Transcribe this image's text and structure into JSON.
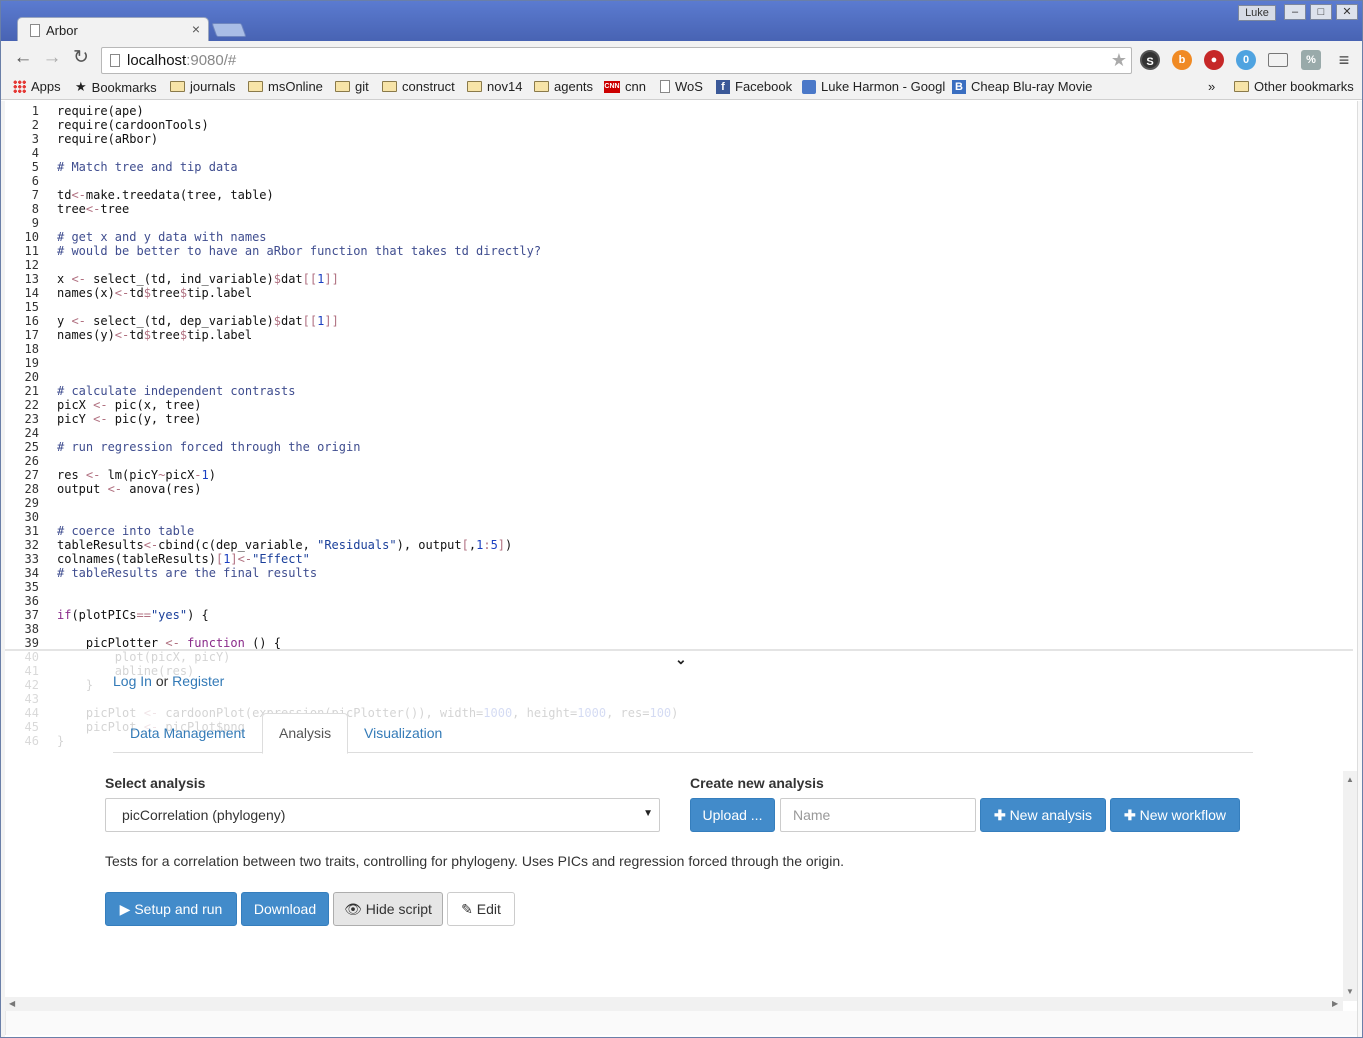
{
  "browser": {
    "tab_title": "Arbor",
    "tab_close": "×",
    "user_label": "Luke",
    "url_host": "localhost",
    "url_rest": ":9080/#",
    "bookmarks": [
      {
        "label": "Apps",
        "icon": "apps-grid-icon"
      },
      {
        "label": "Bookmarks",
        "icon": "star-icon"
      },
      {
        "label": "journals",
        "icon": "folder-icon"
      },
      {
        "label": "msOnline",
        "icon": "folder-icon"
      },
      {
        "label": "git",
        "icon": "folder-icon"
      },
      {
        "label": "construct",
        "icon": "folder-icon"
      },
      {
        "label": "nov14",
        "icon": "folder-icon"
      },
      {
        "label": "agents",
        "icon": "folder-icon"
      },
      {
        "label": "cnn",
        "icon": "cnn-icon"
      },
      {
        "label": "WoS",
        "icon": "page-icon"
      },
      {
        "label": "Facebook",
        "icon": "facebook-icon"
      },
      {
        "label": "Luke Harmon - Googl",
        "icon": "scholar-icon"
      },
      {
        "label": "Cheap Blu-ray Movie",
        "icon": "bluray-icon"
      }
    ],
    "overflow": "»",
    "other_bookmarks": "Other bookmarks",
    "extension_badge": "0"
  },
  "editor": {
    "lines": [
      {
        "n": "1",
        "code": [
          [
            "require(ape)",
            ""
          ]
        ]
      },
      {
        "n": "2",
        "code": [
          [
            "require(cardoonTools)",
            ""
          ]
        ]
      },
      {
        "n": "3",
        "code": [
          [
            "require(aRbor)",
            ""
          ]
        ]
      },
      {
        "n": "4",
        "code": []
      },
      {
        "n": "5",
        "code": [
          [
            "# Match tree and tip data",
            "c-comment"
          ]
        ]
      },
      {
        "n": "6",
        "code": []
      },
      {
        "n": "7",
        "code": [
          [
            "td",
            ""
          ],
          [
            "<-",
            "c-op"
          ],
          [
            "make.treedata(tree, table)",
            ""
          ]
        ]
      },
      {
        "n": "8",
        "code": [
          [
            "tree",
            ""
          ],
          [
            "<-",
            "c-op"
          ],
          [
            "tree",
            ""
          ]
        ]
      },
      {
        "n": "9",
        "code": []
      },
      {
        "n": "10",
        "code": [
          [
            "# get x and y data with names",
            "c-comment"
          ]
        ]
      },
      {
        "n": "11",
        "code": [
          [
            "# would be better to have an aRbor function that takes td directly?",
            "c-comment"
          ]
        ]
      },
      {
        "n": "12",
        "code": []
      },
      {
        "n": "13",
        "code": [
          [
            "x ",
            ""
          ],
          [
            "<-",
            "c-op"
          ],
          [
            " select_(td, ind_variable)",
            ""
          ],
          [
            "$",
            "c-op"
          ],
          [
            "dat",
            ""
          ],
          [
            "[[",
            "c-op"
          ],
          [
            "1",
            "c-num"
          ],
          [
            "]]",
            "c-op"
          ]
        ]
      },
      {
        "n": "14",
        "code": [
          [
            "names(x)",
            ""
          ],
          [
            "<-",
            "c-op"
          ],
          [
            "td",
            ""
          ],
          [
            "$",
            "c-op"
          ],
          [
            "tree",
            ""
          ],
          [
            "$",
            "c-op"
          ],
          [
            "tip.label",
            ""
          ]
        ]
      },
      {
        "n": "15",
        "code": []
      },
      {
        "n": "16",
        "code": [
          [
            "y ",
            ""
          ],
          [
            "<-",
            "c-op"
          ],
          [
            " select_(td, dep_variable)",
            ""
          ],
          [
            "$",
            "c-op"
          ],
          [
            "dat",
            ""
          ],
          [
            "[[",
            "c-op"
          ],
          [
            "1",
            "c-num"
          ],
          [
            "]]",
            "c-op"
          ]
        ]
      },
      {
        "n": "17",
        "code": [
          [
            "names(y)",
            ""
          ],
          [
            "<-",
            "c-op"
          ],
          [
            "td",
            ""
          ],
          [
            "$",
            "c-op"
          ],
          [
            "tree",
            ""
          ],
          [
            "$",
            "c-op"
          ],
          [
            "tip.label",
            ""
          ]
        ]
      },
      {
        "n": "18",
        "code": []
      },
      {
        "n": "19",
        "code": []
      },
      {
        "n": "20",
        "code": []
      },
      {
        "n": "21",
        "code": [
          [
            "# calculate independent contrasts",
            "c-comment"
          ]
        ]
      },
      {
        "n": "22",
        "code": [
          [
            "picX ",
            ""
          ],
          [
            "<-",
            "c-op"
          ],
          [
            " pic(x, tree)",
            ""
          ]
        ]
      },
      {
        "n": "23",
        "code": [
          [
            "picY ",
            ""
          ],
          [
            "<-",
            "c-op"
          ],
          [
            " pic(y, tree)",
            ""
          ]
        ]
      },
      {
        "n": "24",
        "code": []
      },
      {
        "n": "25",
        "code": [
          [
            "# run regression forced through the origin",
            "c-comment"
          ]
        ]
      },
      {
        "n": "26",
        "code": []
      },
      {
        "n": "27",
        "code": [
          [
            "res ",
            ""
          ],
          [
            "<-",
            "c-op"
          ],
          [
            " lm(picY",
            ""
          ],
          [
            "~",
            "c-op"
          ],
          [
            "picX",
            ""
          ],
          [
            "-",
            "c-op"
          ],
          [
            "1",
            "c-num"
          ],
          [
            ")",
            ""
          ]
        ]
      },
      {
        "n": "28",
        "code": [
          [
            "output ",
            ""
          ],
          [
            "<-",
            "c-op"
          ],
          [
            " anova(res)",
            ""
          ]
        ]
      },
      {
        "n": "29",
        "code": []
      },
      {
        "n": "30",
        "code": []
      },
      {
        "n": "31",
        "code": [
          [
            "# coerce into table",
            "c-comment"
          ]
        ]
      },
      {
        "n": "32",
        "code": [
          [
            "tableResults",
            ""
          ],
          [
            "<-",
            "c-op"
          ],
          [
            "cbind(c(dep_variable, ",
            ""
          ],
          [
            "\"Residuals\"",
            "c-str"
          ],
          [
            "), output",
            ""
          ],
          [
            "[",
            "c-op"
          ],
          [
            ",",
            ""
          ],
          [
            "1",
            "c-num"
          ],
          [
            ":",
            "c-op"
          ],
          [
            "5",
            "c-num"
          ],
          [
            "]",
            "c-op"
          ],
          [
            ")",
            ""
          ]
        ]
      },
      {
        "n": "33",
        "code": [
          [
            "colnames(tableResults)",
            ""
          ],
          [
            "[",
            "c-op"
          ],
          [
            "1",
            "c-num"
          ],
          [
            "]",
            "c-op"
          ],
          [
            "<-",
            "c-op"
          ],
          [
            "\"Effect\"",
            "c-str"
          ]
        ]
      },
      {
        "n": "34",
        "code": [
          [
            "# tableResults are the final results",
            "c-comment"
          ]
        ]
      },
      {
        "n": "35",
        "code": []
      },
      {
        "n": "36",
        "code": []
      },
      {
        "n": "37",
        "code": [
          [
            "if",
            "c-kw"
          ],
          [
            "(plotPICs",
            ""
          ],
          [
            "==",
            "c-op"
          ],
          [
            "\"yes\"",
            "c-str"
          ],
          [
            ") {",
            ""
          ]
        ]
      },
      {
        "n": "38",
        "code": []
      },
      {
        "n": "39",
        "code": [
          [
            "    picPlotter ",
            ""
          ],
          [
            "<-",
            "c-op"
          ],
          [
            " ",
            ""
          ],
          [
            "function",
            "c-kw"
          ],
          [
            " () {",
            ""
          ]
        ]
      },
      {
        "n": "40",
        "code": [
          [
            "        plot(picX, picY)",
            ""
          ]
        ]
      },
      {
        "n": "41",
        "code": [
          [
            "        abline(res)",
            ""
          ]
        ]
      },
      {
        "n": "42",
        "code": [
          [
            "    }",
            ""
          ]
        ]
      },
      {
        "n": "43",
        "code": []
      },
      {
        "n": "44",
        "code": [
          [
            "    picPlot ",
            ""
          ],
          [
            "<-",
            "c-op"
          ],
          [
            " cardoonPlot(expression(picPlotter()), width=",
            ""
          ],
          [
            "1000",
            "c-num"
          ],
          [
            ", height=",
            ""
          ],
          [
            "1000",
            "c-num"
          ],
          [
            ", res=",
            ""
          ],
          [
            "100",
            "c-num"
          ],
          [
            ")",
            ""
          ]
        ]
      },
      {
        "n": "45",
        "code": [
          [
            "    picPlot ",
            ""
          ],
          [
            "<-",
            "c-op"
          ],
          [
            " picPlot$png",
            ""
          ]
        ]
      },
      {
        "n": "46",
        "code": [
          [
            "}",
            ""
          ]
        ]
      }
    ]
  },
  "auth": {
    "login": "Log In",
    "or": "or",
    "register": "Register"
  },
  "tabs": [
    "Data Management",
    "Analysis",
    "Visualization"
  ],
  "analysis": {
    "select_label": "Select analysis",
    "selected": "picCorrelation (phylogeny)",
    "create_label": "Create new analysis",
    "upload_button": "Upload ...",
    "name_placeholder": "Name",
    "new_analysis_button": "New analysis",
    "new_workflow_button": "New workflow",
    "description": "Tests for a correlation between two traits, controlling for phylogeny. Uses PICs and regression forced through the origin.",
    "setup_button": "Setup and run",
    "download_button": "Download",
    "hide_script_button": "Hide script",
    "edit_button": "Edit"
  },
  "colors": {
    "primary": "#428bca",
    "link": "#337ab7",
    "chrome": "#4a6ab8"
  }
}
